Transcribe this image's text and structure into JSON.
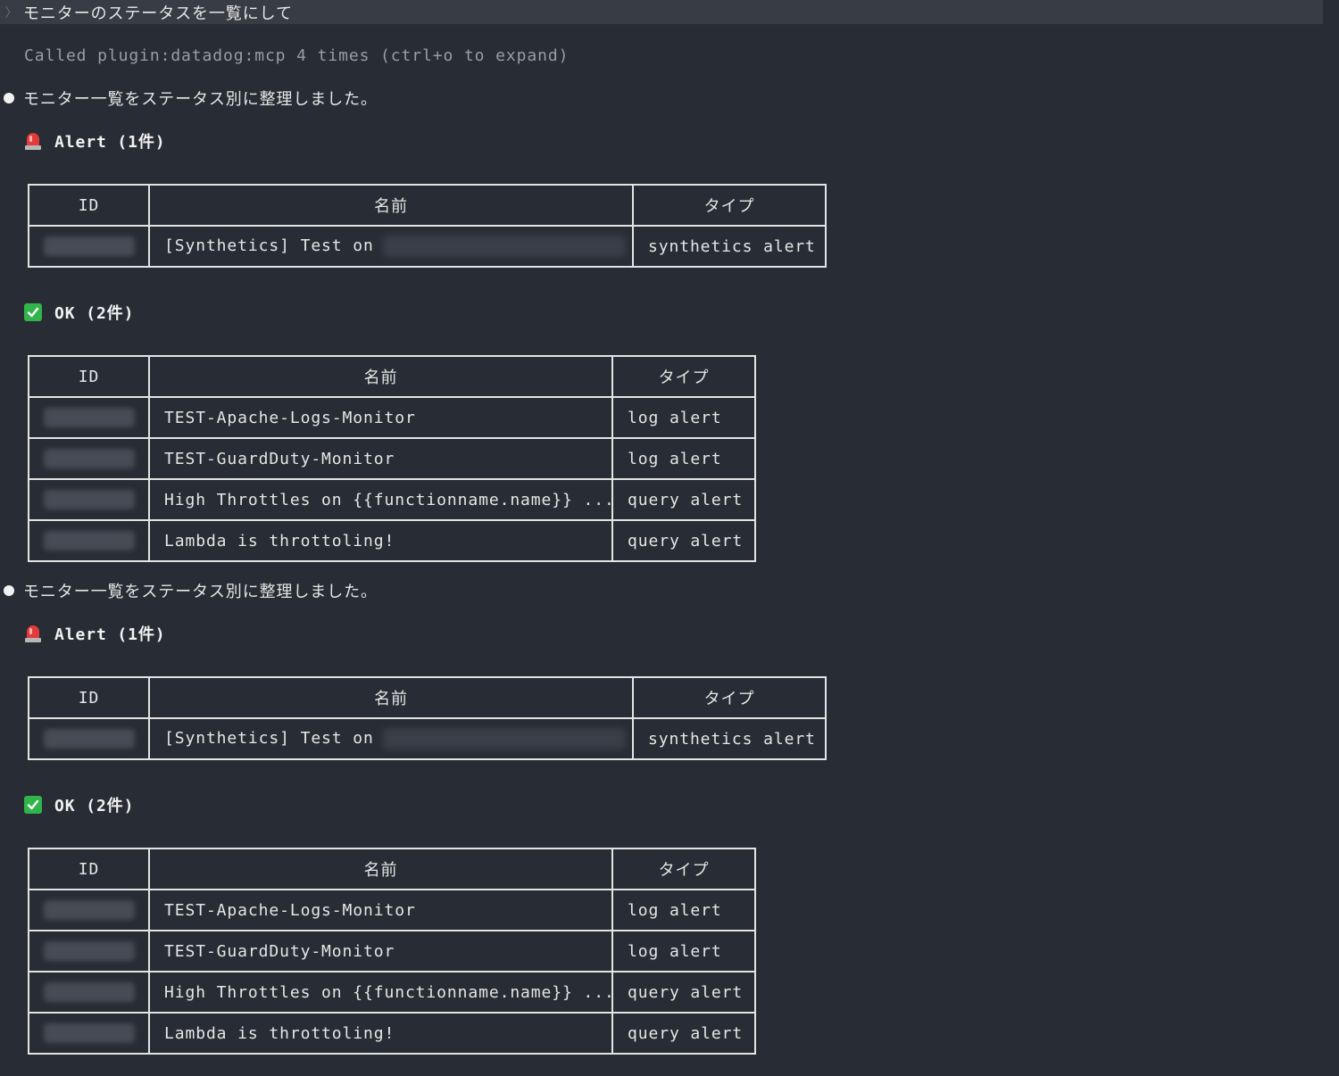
{
  "prompt": {
    "glyph": "〉",
    "text": "モニターのステータスを一覧にして"
  },
  "tool_call": {
    "text": "Called plugin:datadog:mcp 4 times (ctrl+o to expand)"
  },
  "responses": [
    {
      "summary": "モニター一覧をステータス別に整理しました。",
      "alert": {
        "heading": "Alert (1件)",
        "icon": "siren-icon",
        "columns": [
          "ID",
          "名前",
          "タイプ"
        ],
        "rows": [
          {
            "id": "",
            "name": "[Synthetics] Test on",
            "type": "synthetics alert"
          }
        ]
      },
      "ok": {
        "heading": "OK (2件)",
        "icon": "check-icon",
        "columns": [
          "ID",
          "名前",
          "タイプ"
        ],
        "rows": [
          {
            "id": "",
            "name": "TEST-Apache-Logs-Monitor",
            "type": "log alert"
          },
          {
            "id": "",
            "name": "TEST-GuardDuty-Monitor",
            "type": "log alert"
          },
          {
            "id": "",
            "name": "High Throttles on {{functionname.name}} ...",
            "type": "query alert"
          },
          {
            "id": "",
            "name": "Lambda is throttoling!",
            "type": "query alert"
          }
        ]
      }
    },
    {
      "summary": "モニター一覧をステータス別に整理しました。",
      "alert": {
        "heading": "Alert (1件)",
        "icon": "siren-icon",
        "columns": [
          "ID",
          "名前",
          "タイプ"
        ],
        "rows": [
          {
            "id": "",
            "name": "[Synthetics] Test on",
            "type": "synthetics alert"
          }
        ]
      },
      "ok": {
        "heading": "OK (2件)",
        "icon": "check-icon",
        "columns": [
          "ID",
          "名前",
          "タイプ"
        ],
        "rows": [
          {
            "id": "",
            "name": "TEST-Apache-Logs-Monitor",
            "type": "log alert"
          },
          {
            "id": "",
            "name": "TEST-GuardDuty-Monitor",
            "type": "log alert"
          },
          {
            "id": "",
            "name": "High Throttles on {{functionname.name}} ...",
            "type": "query alert"
          },
          {
            "id": "",
            "name": "Lambda is throttoling!",
            "type": "query alert"
          }
        ]
      }
    }
  ],
  "colors": {
    "background": "#282c34",
    "text": "#e6e6e6",
    "muted": "#9a9da3",
    "alert_red": "#e23b3b",
    "ok_green": "#31b44a"
  }
}
